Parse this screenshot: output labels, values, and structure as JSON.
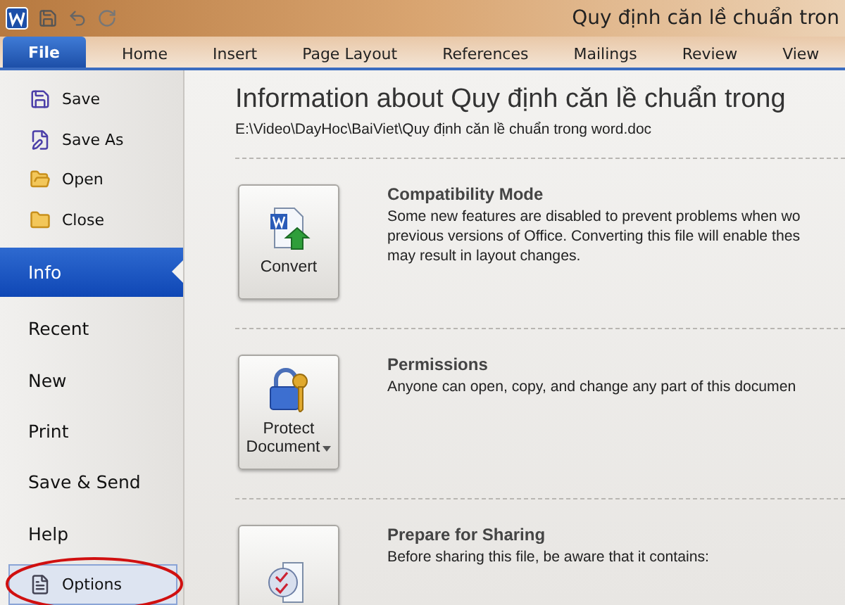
{
  "window": {
    "title": "Quy định căn lề chuẩn tron"
  },
  "tabs": [
    {
      "label": "File",
      "selected": true
    },
    {
      "label": "Home",
      "selected": false
    },
    {
      "label": "Insert",
      "selected": false
    },
    {
      "label": "Page Layout",
      "selected": false
    },
    {
      "label": "References",
      "selected": false
    },
    {
      "label": "Mailings",
      "selected": false
    },
    {
      "label": "Review",
      "selected": false
    },
    {
      "label": "View",
      "selected": false
    }
  ],
  "sidebar": {
    "items": [
      {
        "kind": "command",
        "label": "Save",
        "selected": false,
        "hovered": false,
        "circled": false
      },
      {
        "kind": "command",
        "label": "Save As",
        "selected": false,
        "hovered": false,
        "circled": false
      },
      {
        "kind": "command",
        "label": "Open",
        "selected": false,
        "hovered": false,
        "circled": false
      },
      {
        "kind": "command",
        "label": "Close",
        "selected": false,
        "hovered": false,
        "circled": false
      },
      {
        "kind": "page",
        "label": "Info",
        "selected": true,
        "hovered": false,
        "circled": false
      },
      {
        "kind": "page",
        "label": "Recent",
        "selected": false,
        "hovered": false,
        "circled": false
      },
      {
        "kind": "page",
        "label": "New",
        "selected": false,
        "hovered": false,
        "circled": false
      },
      {
        "kind": "page",
        "label": "Print",
        "selected": false,
        "hovered": false,
        "circled": false
      },
      {
        "kind": "page",
        "label": "Save & Send",
        "selected": false,
        "hovered": false,
        "circled": false
      },
      {
        "kind": "page",
        "label": "Help",
        "selected": false,
        "hovered": false,
        "circled": false
      },
      {
        "kind": "command",
        "label": "Options",
        "selected": false,
        "hovered": true,
        "circled": true
      }
    ]
  },
  "info": {
    "heading": "Information about Quy định căn lề chuẩn trong",
    "path": "E:\\Video\\DayHoc\\BaiViet\\Quy định căn lề chuẩn trong word.doc",
    "sections": [
      {
        "button": [
          "Convert"
        ],
        "dropdown": false,
        "title": "Compatibility Mode",
        "lines": [
          "Some new features are disabled to prevent problems when wo",
          "previous versions of Office. Converting this file will enable thes",
          "may result in layout changes."
        ]
      },
      {
        "button": [
          "Protect",
          "Document"
        ],
        "dropdown": true,
        "title": "Permissions",
        "lines": [
          "Anyone can open, copy, and change any part of this documen"
        ]
      },
      {
        "dropdown": false,
        "title": "Prepare for Sharing",
        "lines": [
          "Before sharing this file, be aware that it contains:"
        ]
      }
    ]
  }
}
